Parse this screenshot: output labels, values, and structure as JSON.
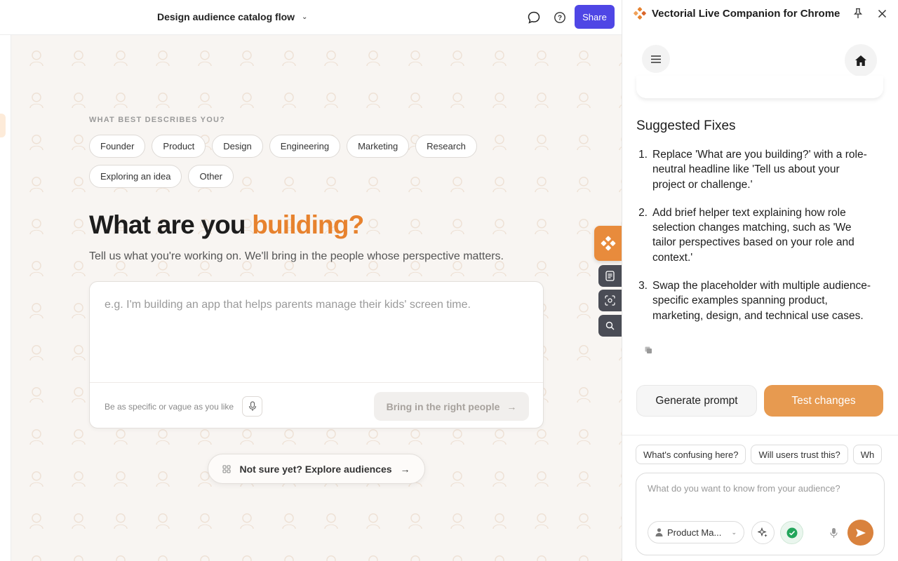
{
  "topbar": {
    "doc_title": "Design audience catalog flow",
    "chevron_icon": "chevron-down-icon",
    "comment_icon": "chat-bubble-icon",
    "help_icon": "help-circle-icon",
    "share_label": "Share",
    "share_color": "#4f46e5"
  },
  "main": {
    "role_label": "WHAT BEST DESCRIBES YOU?",
    "roles": [
      "Founder",
      "Product",
      "Design",
      "Engineering",
      "Marketing",
      "Research",
      "Exploring an idea",
      "Other"
    ],
    "headline_prefix": "What are you",
    "headline_accent": "building?",
    "accent_color": "#e7822e",
    "subhead": "Tell us what you're working on. We'll bring in the people whose perspective matters.",
    "input_placeholder": "e.g. I'm building an app that helps parents manage their kids' screen time.",
    "input_value": "",
    "hint": "Be as specific or vague as you like",
    "submit_label": "Bring in the right people",
    "submit_arrow": "→",
    "explore_label": "Not sure yet? Explore audiences",
    "explore_arrow": "→"
  },
  "panel": {
    "title": "Vectorial Live Companion for Chrome",
    "section_title": "Suggested Fixes",
    "fixes": [
      {
        "num": "1.",
        "text": "Replace 'What are you building?' with a role-neutral headline like 'Tell us about your project or challenge.'"
      },
      {
        "num": "2.",
        "text": "Add brief helper text explaining how role selection changes matching, such as 'We tailor perspectives based on your role and context.'"
      },
      {
        "num": "3.",
        "text": "Swap the placeholder with multiple audience-specific examples spanning product, marketing, design, and technical use cases."
      }
    ],
    "generate_label": "Generate prompt",
    "test_label": "Test changes",
    "test_color": "#e79a50",
    "suggestions": [
      "What's confusing here?",
      "Will users trust this?",
      "Wh"
    ],
    "composer_placeholder": "What do you want to know from your audience?",
    "persona_label": "Product Ma...",
    "send_color": "#d9823d"
  }
}
